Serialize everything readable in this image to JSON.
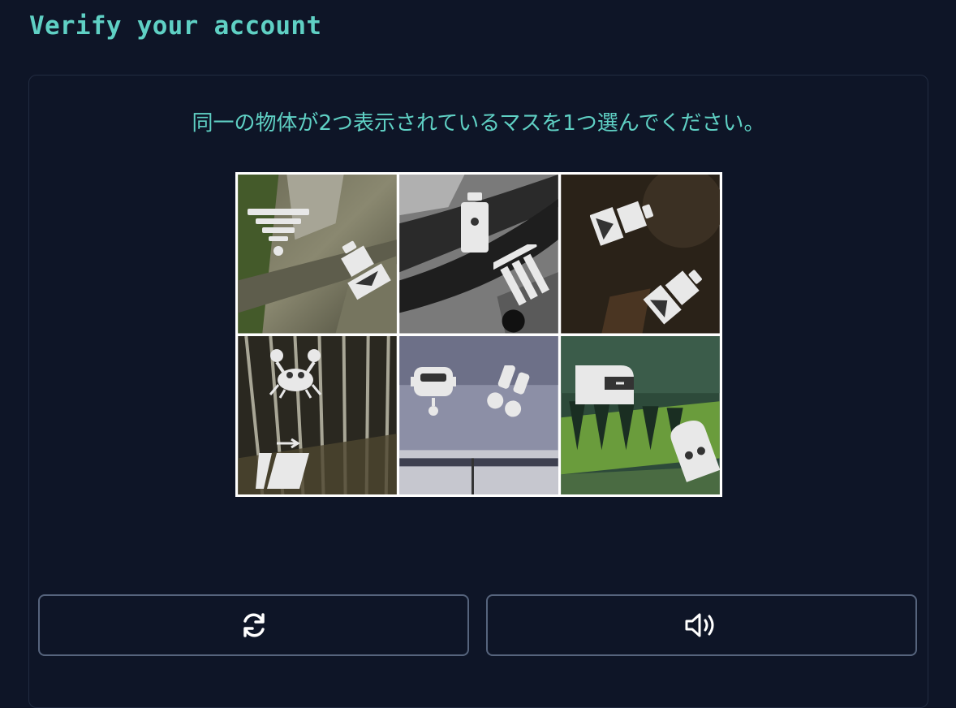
{
  "header": {
    "title": "Verify your account"
  },
  "challenge": {
    "instruction": "同一の物体が2つ表示されているマスを1つ選んでください。",
    "tiles": [
      {
        "icons": [
          "filter-funnel-icon",
          "blender-icon"
        ]
      },
      {
        "icons": [
          "bottle-icon",
          "stacked-pillar-icon"
        ]
      },
      {
        "icons": [
          "blender-icon",
          "blender-icon"
        ]
      },
      {
        "icons": [
          "crab-icon",
          "arrow-folder-icon"
        ]
      },
      {
        "icons": [
          "robot-head-icon",
          "dice-shaker-icon"
        ]
      },
      {
        "icons": [
          "eraser-icon",
          "ghost-icon"
        ]
      }
    ]
  },
  "controls": {
    "refresh_icon": "refresh-icon",
    "audio_icon": "speaker-icon"
  },
  "colors": {
    "background": "#0e1527",
    "accent": "#5fd0c4",
    "border": "#56647d"
  }
}
